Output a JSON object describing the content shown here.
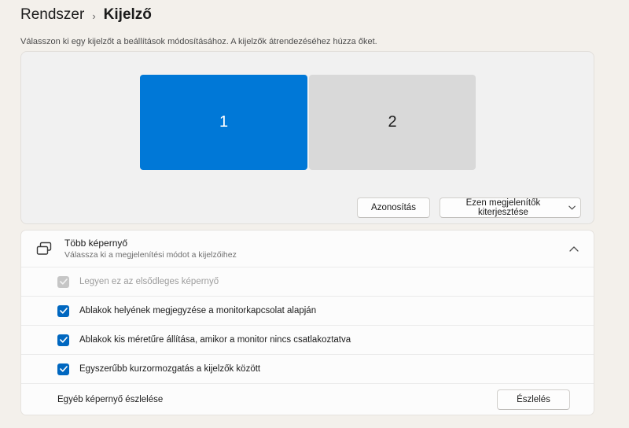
{
  "page": {
    "breadcrumb_parent": "Rendszer",
    "breadcrumb_separator": "›",
    "breadcrumb_current": "Kijelző",
    "subtitle": "Válasszon ki egy kijelzőt a beállítások módosításához. A kijelzők átrendezéséhez húzza őket."
  },
  "arrangement": {
    "monitor1_label": "1",
    "monitor2_label": "2",
    "identify_button": "Azonosítás",
    "mode_dropdown_label": "Ezen megjelenítők kiterjesztése"
  },
  "multi_display": {
    "title": "Több képernyő",
    "subtitle": "Válassza ki a megjelenítési módot a kijelzőihez",
    "expanded": true,
    "rows": [
      {
        "label": "Legyen ez az elsődleges képernyő",
        "checked": true,
        "disabled": true
      },
      {
        "label": "Ablakok helyének megjegyzése a monitorkapcsolat alapján",
        "checked": true,
        "disabled": false
      },
      {
        "label": "Ablakok kis méretűre állítása, amikor a monitor nincs csatlakoztatva",
        "checked": true,
        "disabled": false
      },
      {
        "label": "Egyszerűbb kurzormozgatás a kijelzők között",
        "checked": true,
        "disabled": false
      }
    ],
    "detect_label": "Egyéb képernyő észlelése",
    "detect_button": "Észlelés"
  },
  "icons": {
    "breadcrumb_chevron": "chevron-right",
    "dropdown_chevron": "chevron-down",
    "accordion_chevron": "chevron-up",
    "section_icon": "multi-display",
    "checkbox_glyph": "checkmark"
  },
  "colors": {
    "accent_monitor": "#0078d7",
    "inactive_monitor": "#d9d9d9",
    "checkbox_accent": "#0067c0",
    "page_background": "#f3f0eb",
    "card_background": "#fcfcfc"
  }
}
